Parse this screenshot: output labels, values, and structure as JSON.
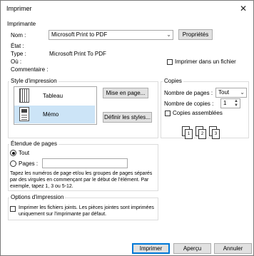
{
  "window": {
    "title": "Imprimer",
    "close_glyph": "✕"
  },
  "printer": {
    "group_label": "Imprimante",
    "name_label": "Nom :",
    "name_value": "Microsoft Print to PDF",
    "properties_button": "Propriétés",
    "status_label": "État :",
    "type_label": "Type :",
    "type_value": "Microsoft Print To PDF",
    "where_label": "Où :",
    "comment_label": "Commentaire :",
    "print_to_file_label": "Imprimer dans un fichier"
  },
  "print_style": {
    "group_label": "Style d'impression",
    "styles": [
      {
        "label": "Tableau",
        "icon": "table-style-icon",
        "selected": false
      },
      {
        "label": "Mémo",
        "icon": "memo-style-icon",
        "selected": true
      }
    ],
    "page_setup_button": "Mise en page...",
    "define_styles_button": "Définir les styles..."
  },
  "copies": {
    "group_label": "Copies",
    "pages_label": "Nombre de pages :",
    "pages_value": "Tout",
    "copies_label": "Nombre de copies :",
    "copies_value": "1",
    "collate_label": "Copies assemblées",
    "collate_pages": [
      "1",
      "2",
      "3"
    ]
  },
  "page_range": {
    "group_label": "Étendue de pages",
    "all_label": "Tout",
    "pages_label": "Pages :",
    "pages_value": "",
    "help_text": "Tapez les numéros de page et/ou les groupes de pages séparés par des virgules en commençant par le début de l'élément. Par exemple, tapez 1, 3 ou 5-12."
  },
  "print_options": {
    "group_label": "Options d'impression",
    "attachments_label": "Imprimer les fichiers joints. Les pièces jointes sont imprimées uniquement sur l'imprimante par défaut."
  },
  "footer": {
    "print_button": "Imprimer",
    "preview_button": "Aperçu",
    "cancel_button": "Annuler"
  }
}
